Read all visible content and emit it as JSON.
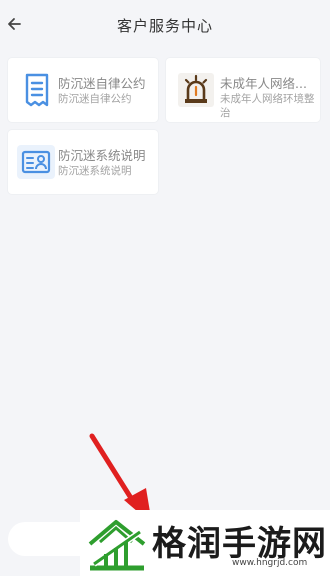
{
  "header": {
    "title": "客户服务中心",
    "back_icon": "arrow-left-icon"
  },
  "cards": [
    {
      "title": "防沉迷自律公约",
      "subtitle": "防沉迷自律公约",
      "icon": "document-icon"
    },
    {
      "title": "未成年人网络...",
      "subtitle": "未成年人网络环境整治",
      "icon": "alarm-light-icon"
    },
    {
      "title": "防沉迷系统说明",
      "subtitle": "防沉迷系统说明",
      "icon": "id-card-icon"
    }
  ],
  "watermark": {
    "text": "格润手游网",
    "url": "www.hngrjd.com"
  },
  "colors": {
    "background": "#f4f5f8",
    "card": "#ffffff",
    "icon_blue": "#4a90e2",
    "alarm_brown": "#5a3a1a",
    "arrow_red": "#e02020",
    "logo_green": "#2e9e2e"
  }
}
